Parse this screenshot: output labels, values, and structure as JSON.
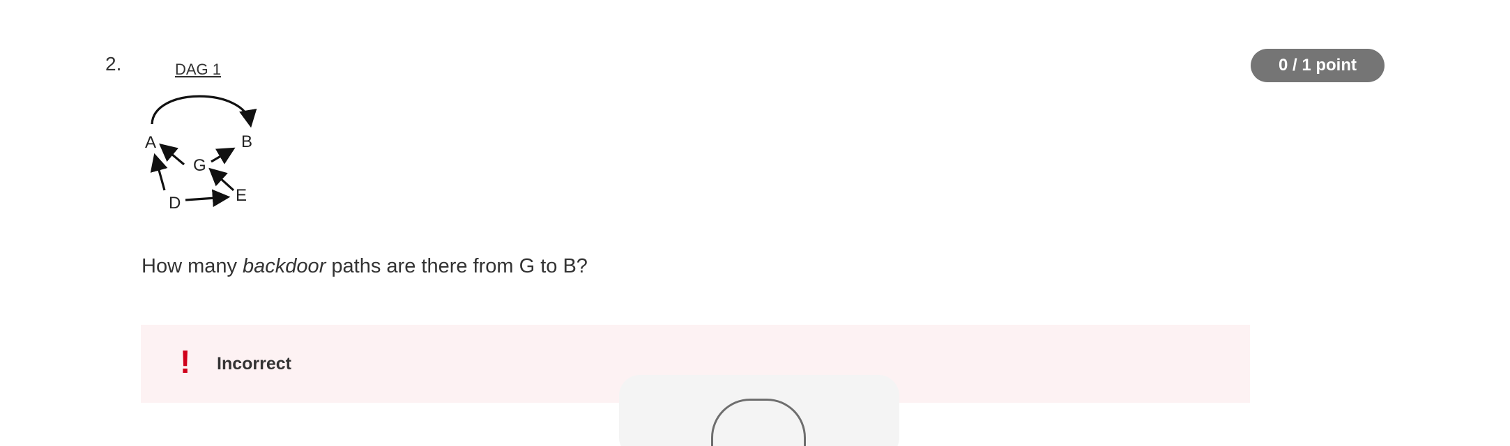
{
  "question": {
    "number": "2.",
    "text_before": "How many ",
    "text_emphasis": "backdoor",
    "text_after": " paths are there from G to B?",
    "points_badge": "0 / 1 point"
  },
  "dag": {
    "title": "DAG 1",
    "nodes": [
      "A",
      "B",
      "G",
      "D",
      "E"
    ],
    "edges": [
      {
        "from": "A",
        "to": "B",
        "style": "curved"
      },
      {
        "from": "G",
        "to": "A"
      },
      {
        "from": "G",
        "to": "B"
      },
      {
        "from": "D",
        "to": "A"
      },
      {
        "from": "D",
        "to": "E"
      },
      {
        "from": "E",
        "to": "G"
      }
    ]
  },
  "feedback": {
    "icon": "!",
    "label": "Incorrect"
  },
  "colors": {
    "badge_bg": "#757575",
    "feedback_bg": "#fdf2f3",
    "error_red": "#d0021b",
    "text": "#333333"
  }
}
